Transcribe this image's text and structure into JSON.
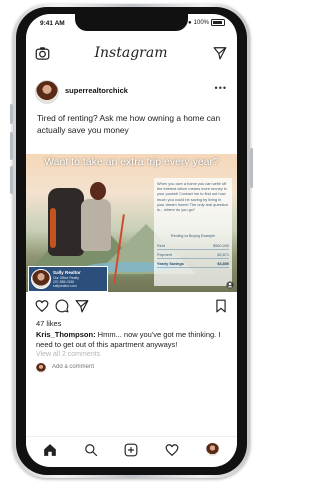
{
  "status_bar": {
    "time": "9:41 AM",
    "battery": "100%"
  },
  "app": {
    "title": "Instagram"
  },
  "post": {
    "username": "superrealtorchick",
    "caption": "Tired of renting?  Ask me how owning a home can actually save you money",
    "image": {
      "headline": "Want to take an extra trip every year?",
      "info_text": "When you own a home you can write off the interest which means more money in your pocket! Contact me to find out how much you could be saving by living in your dream home! The only real question is... where do you go?",
      "table_title": "Renting vs Buying Example",
      "rows": [
        {
          "label": "Rent",
          "value": "$560,000"
        },
        {
          "label": "Payment",
          "value": "$2,871"
        },
        {
          "label": "Yearly Savings",
          "value": "$3,850"
        }
      ],
      "agent": {
        "name": "Sally Realtor",
        "lines": [
          "Our Office Realty",
          "207-555-0156",
          "sallyrealtor.com"
        ]
      }
    },
    "likes": "47 likes",
    "comment": {
      "user": "Kris_Thompson:",
      "text": " Hmm... now you've got me thinking. I need to get out of this apartment anyways!"
    },
    "view_all": "View all 2 comments",
    "add_comment_placeholder": "Add a comment"
  }
}
